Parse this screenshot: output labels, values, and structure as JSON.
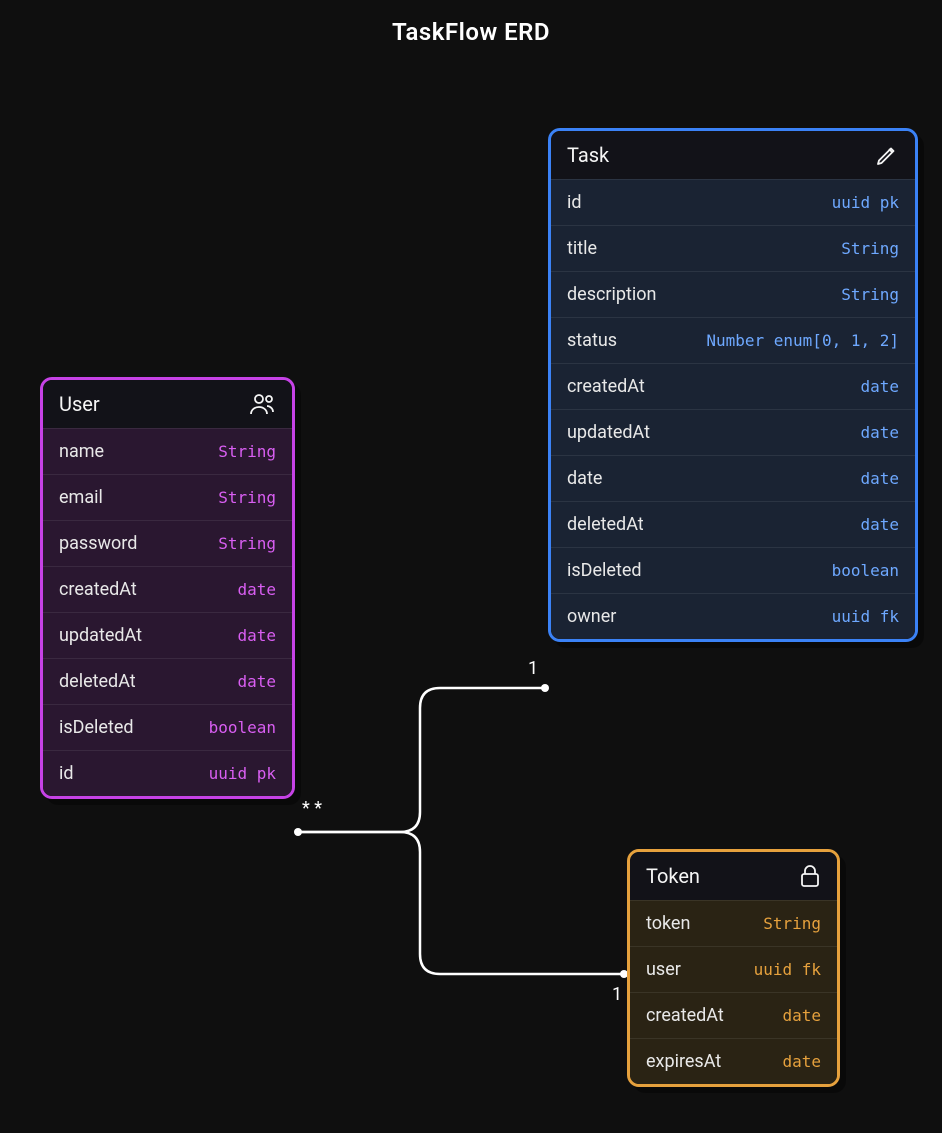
{
  "title": "TaskFlow ERD",
  "entities": {
    "user": {
      "name": "User",
      "icon": "users-icon",
      "fields": [
        {
          "name": "name",
          "type": "String"
        },
        {
          "name": "email",
          "type": "String"
        },
        {
          "name": "password",
          "type": "String"
        },
        {
          "name": "createdAt",
          "type": "date"
        },
        {
          "name": "updatedAt",
          "type": "date"
        },
        {
          "name": "deletedAt",
          "type": "date"
        },
        {
          "name": "isDeleted",
          "type": "boolean"
        },
        {
          "name": "id",
          "type": "uuid pk"
        }
      ]
    },
    "task": {
      "name": "Task",
      "icon": "pencil-icon",
      "fields": [
        {
          "name": "id",
          "type": "uuid pk"
        },
        {
          "name": "title",
          "type": "String"
        },
        {
          "name": "description",
          "type": "String"
        },
        {
          "name": "status",
          "type": "Number enum[0, 1, 2]"
        },
        {
          "name": "createdAt",
          "type": "date"
        },
        {
          "name": "updatedAt",
          "type": "date"
        },
        {
          "name": "date",
          "type": "date"
        },
        {
          "name": "deletedAt",
          "type": "date"
        },
        {
          "name": "isDeleted",
          "type": "boolean"
        },
        {
          "name": "owner",
          "type": "uuid fk"
        }
      ]
    },
    "token": {
      "name": "Token",
      "icon": "lock-icon",
      "fields": [
        {
          "name": "token",
          "type": "String"
        },
        {
          "name": "user",
          "type": "uuid fk"
        },
        {
          "name": "createdAt",
          "type": "date"
        },
        {
          "name": "expiresAt",
          "type": "date"
        }
      ]
    }
  },
  "relationships": [
    {
      "from": "user.id",
      "to": "task.owner",
      "from_cardinality": "* *",
      "to_cardinality": "1"
    },
    {
      "from": "user.id",
      "to": "token.user",
      "from_cardinality": "* *",
      "to_cardinality": "1"
    }
  ],
  "labels": {
    "user_side": "* *",
    "task_side": "1",
    "token_side": "1"
  }
}
